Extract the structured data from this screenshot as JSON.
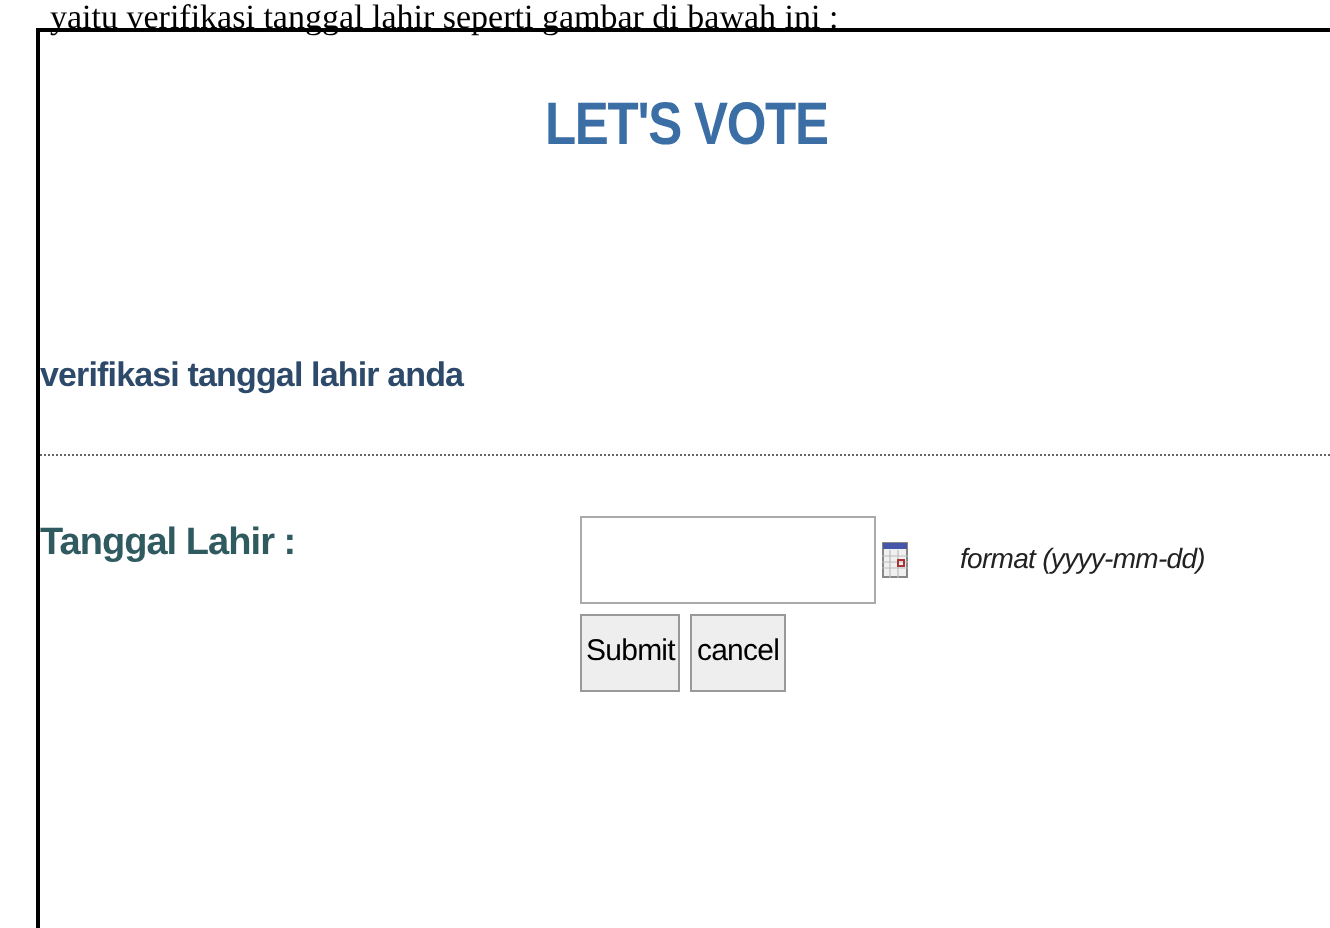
{
  "caption": "yaitu verifikasi tanggal lahir seperti gambar di bawah ini :",
  "title": "LET'S VOTE",
  "subtitle": "verifikasi tanggal lahir anda",
  "field": {
    "label": "Tanggal Lahir :",
    "hint": "format (yyyy-mm-dd)"
  },
  "buttons": [
    "Submit",
    "cancel"
  ]
}
